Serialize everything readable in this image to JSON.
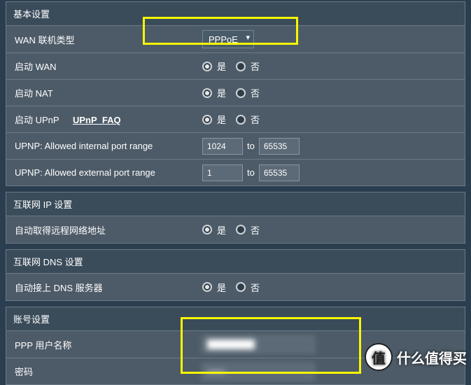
{
  "sections": {
    "basic": {
      "title": "基本设置",
      "wan_type_label": "WAN 联机类型",
      "wan_type_value": "PPPoE",
      "enable_wan_label": "启动 WAN",
      "enable_nat_label": "启动 NAT",
      "enable_upnp_label": "启动 UPnP",
      "upnp_faq": "UPnP_FAQ",
      "upnp_internal_label": "UPNP: Allowed internal port range",
      "upnp_internal_from": "1024",
      "upnp_internal_to": "65535",
      "upnp_external_label": "UPNP: Allowed external port range",
      "upnp_external_from": "1",
      "upnp_external_to": "65535",
      "to_text": "to"
    },
    "ip": {
      "title": "互联网 IP 设置",
      "auto_ip_label": "自动取得远程网络地址"
    },
    "dns": {
      "title": "互联网 DNS 设置",
      "auto_dns_label": "自动接上 DNS 服务器"
    },
    "account": {
      "title": "账号设置",
      "ppp_user_label": "PPP 用户名称",
      "ppp_user_value": "████████",
      "password_label": "密码",
      "password_value": "██████"
    }
  },
  "radio": {
    "yes": "是",
    "no": "否"
  },
  "watermark": "什么值得买"
}
